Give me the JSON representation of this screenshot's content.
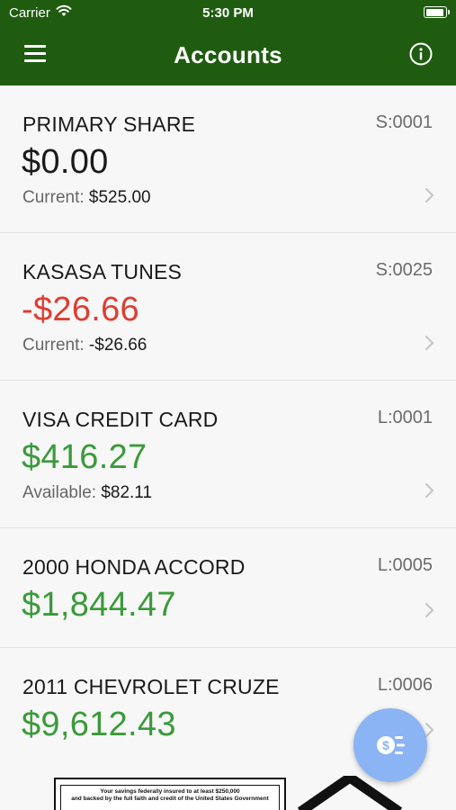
{
  "status_bar": {
    "carrier": "Carrier",
    "time": "5:30 PM"
  },
  "header": {
    "title": "Accounts",
    "menu_icon": "hamburger-menu-icon",
    "info_icon": "info-circle-icon"
  },
  "accounts": [
    {
      "name": "PRIMARY SHARE",
      "id": "S:0001",
      "balance": "$0.00",
      "balance_status": "neutral",
      "sub_label": "Current:",
      "sub_value": "$525.00"
    },
    {
      "name": "KASASA TUNES",
      "id": "S:0025",
      "balance": "-$26.66",
      "balance_status": "negative",
      "sub_label": "Current:",
      "sub_value": "-$26.66"
    },
    {
      "name": "VISA CREDIT CARD",
      "id": "L:0001",
      "balance": "$416.27",
      "balance_status": "positive",
      "sub_label": "Available:",
      "sub_value": "$82.11"
    },
    {
      "name": "2000 HONDA ACCORD",
      "id": "L:0005",
      "balance": "$1,844.47",
      "balance_status": "positive"
    },
    {
      "name": "2011 CHEVROLET CRUZE",
      "id": "L:0006",
      "balance": "$9,612.43",
      "balance_status": "positive"
    }
  ],
  "fab": {
    "icon": "money-transfer-icon"
  },
  "footer": {
    "fdic_text_line1": "Your savings federally insured to at least $250,000",
    "fdic_text_line2": "and backed by the full faith and credit of the United States Government"
  },
  "colors": {
    "header": "#1f5c10",
    "negative": "#e03c31",
    "positive": "#3a9a3a",
    "fab": "#8ab4f4"
  }
}
